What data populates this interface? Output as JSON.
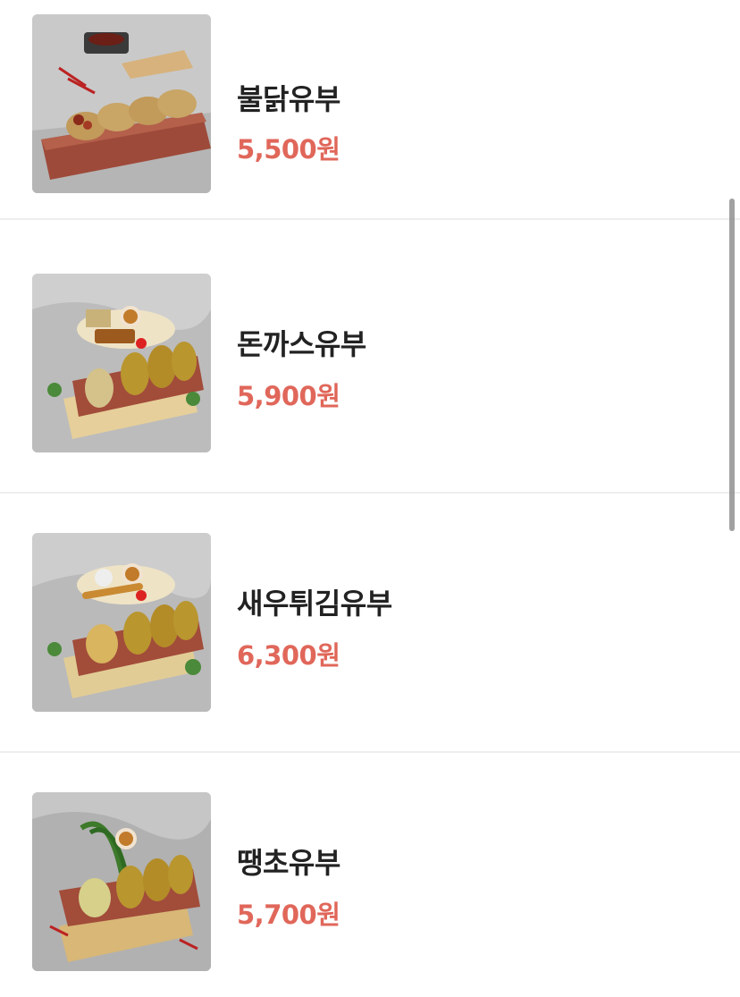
{
  "menu": {
    "items": [
      {
        "name": "불닭유부",
        "price": "5,500원",
        "image_icon": "food-photo-icon"
      },
      {
        "name": "돈까스유부",
        "price": "5,900원",
        "image_icon": "food-photo-icon"
      },
      {
        "name": "새우튀김유부",
        "price": "6,300원",
        "image_icon": "food-photo-icon"
      },
      {
        "name": "땡초유부",
        "price": "5,700원",
        "image_icon": "food-photo-icon"
      }
    ]
  },
  "colors": {
    "price": "#e0675a",
    "name": "#222222",
    "divider": "#eeeeee",
    "background": "#ffffff"
  }
}
